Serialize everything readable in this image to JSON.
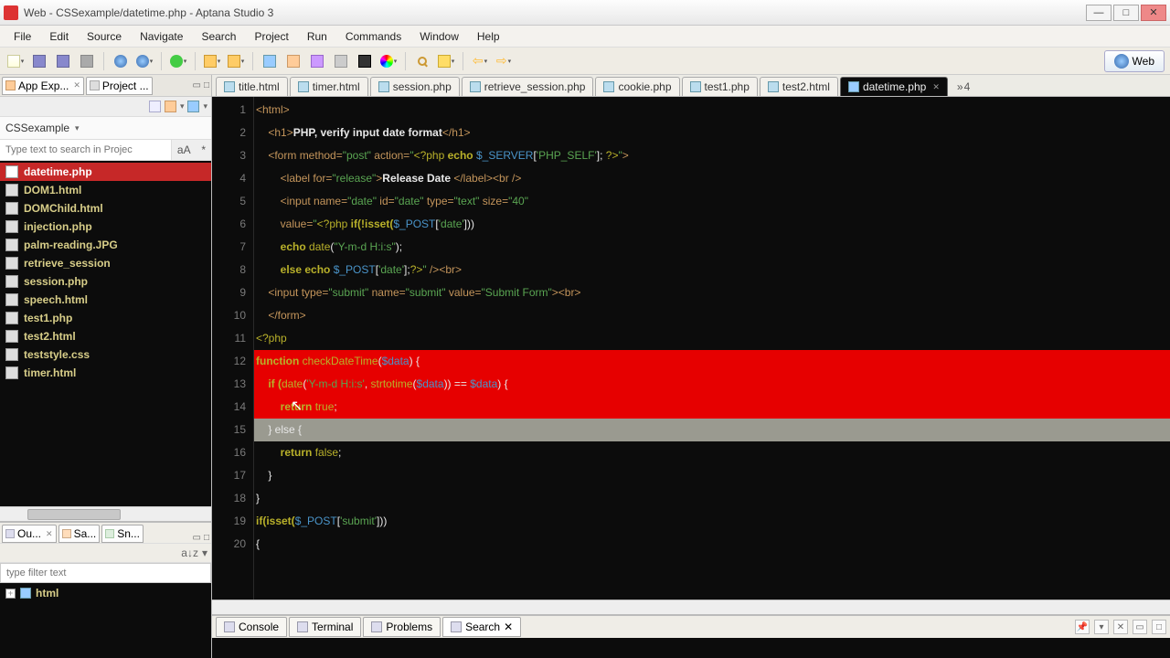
{
  "window": {
    "title": "Web - CSSexample/datetime.php - Aptana Studio 3"
  },
  "menu": [
    "File",
    "Edit",
    "Source",
    "Navigate",
    "Search",
    "Project",
    "Run",
    "Commands",
    "Window",
    "Help"
  ],
  "perspective": {
    "label": "Web"
  },
  "leftViews": {
    "tabs": [
      {
        "label": "App Exp...",
        "closable": true
      },
      {
        "label": "Project ..."
      }
    ],
    "project": "CSSexample",
    "searchPlaceholder": "Type text to search in Projec",
    "searchSide": [
      "aA",
      "*"
    ],
    "files": [
      {
        "name": "datetime.php",
        "selected": true
      },
      {
        "name": "DOM1.html"
      },
      {
        "name": "DOMChild.html"
      },
      {
        "name": "injection.php"
      },
      {
        "name": "palm-reading.JPG"
      },
      {
        "name": "retrieve_session"
      },
      {
        "name": "session.php"
      },
      {
        "name": "speech.html"
      },
      {
        "name": "test1.php"
      },
      {
        "name": "test2.html"
      },
      {
        "name": "teststyle.css"
      },
      {
        "name": "timer.html"
      }
    ]
  },
  "leftBottom": {
    "tabs": [
      {
        "label": "Ou...",
        "closable": true
      },
      {
        "label": "Sa..."
      },
      {
        "label": "Sn..."
      }
    ],
    "filterPlaceholder": "type filter text",
    "rootNode": "html"
  },
  "editorTabs": [
    {
      "label": "title.html"
    },
    {
      "label": "timer.html"
    },
    {
      "label": "session.php"
    },
    {
      "label": "retrieve_session.php"
    },
    {
      "label": "cookie.php"
    },
    {
      "label": "test1.php"
    },
    {
      "label": "test2.html"
    },
    {
      "label": "datetime.php",
      "active": true,
      "closable": true
    }
  ],
  "editorOverflow": {
    "chev": "»",
    "count": "4"
  },
  "code": {
    "lines": [
      1,
      2,
      3,
      4,
      5,
      6,
      7,
      8,
      9,
      10,
      11,
      12,
      13,
      14,
      15,
      16,
      17,
      18,
      19,
      20
    ],
    "l1": {
      "a": "<html>"
    },
    "l2": {
      "a": "    <h1>",
      "b": "PHP, verify input date format",
      "c": "</h1>"
    },
    "l3": {
      "a": "    <form ",
      "b": "method=",
      "c": "\"post\"",
      "d": " action=",
      "e": "\"",
      "f": "<?php",
      "g": " echo ",
      "h": "$_SERVER",
      "i": "[",
      "j": "'PHP_SELF'",
      "k": "]; ",
      "l": "?>",
      "m": "\"",
      "n": ">"
    },
    "l4": {
      "a": "        <label ",
      "b": "for=",
      "c": "\"release\"",
      "d": ">",
      "e": "Release Date ",
      "f": "</label><br />"
    },
    "l5": {
      "a": "        <input ",
      "b": "name=",
      "c": "\"date\"",
      "d": " id=",
      "e": "\"date\"",
      "f": " type=",
      "g": "\"text\"",
      "h": " size=",
      "i": "\"40\""
    },
    "l6": {
      "a": "        value=",
      "b": "\"",
      "c": "<?php",
      "d": " if(!isset(",
      "e": "$_POST",
      "f": "[",
      "g": "'date'",
      "h": "]))"
    },
    "l7": {
      "a": "        echo ",
      "b": "date",
      "c": "(",
      "d": "\"Y-m-d H:i:s\"",
      "e": ");"
    },
    "l8": {
      "a": "        else echo ",
      "b": "$_POST",
      "c": "[",
      "d": "'date'",
      "e": "];",
      "f": "?>",
      "g": "\"",
      "h": " /><br>"
    },
    "l9": {
      "a": "    <input ",
      "b": "type=",
      "c": "\"submit\"",
      "d": " name=",
      "e": "\"submit\"",
      "f": " value=",
      "g": "\"Submit Form\"",
      "h": "><br>"
    },
    "l10": {
      "a": "    </form>"
    },
    "l11": {
      "a": "<?php"
    },
    "l12": {
      "a": "function ",
      "b": "checkDateTime",
      "c": "(",
      "d": "$data",
      "e": ") {"
    },
    "l13": {
      "a": "    if (",
      "b": "date",
      "c": "(",
      "d": "'Y-m-d H:i:s'",
      "e": ", ",
      "f": "strtotime",
      "g": "(",
      "h": "$data",
      "i": ")) == ",
      "j": "$data",
      "k": ") {"
    },
    "l14": {
      "a": "        return ",
      "b": "true",
      "c": ";"
    },
    "l15": {
      "a": "    } else {"
    },
    "l16": {
      "a": "        return ",
      "b": "false",
      "c": ";"
    },
    "l17": {
      "a": "    }"
    },
    "l18": {
      "a": "}"
    },
    "l19": {
      "a": "if(isset(",
      "b": "$_POST",
      "c": "[",
      "d": "'submit'",
      "e": "]))"
    },
    "l20": {
      "a": "{"
    }
  },
  "bottomTabs": [
    {
      "label": "Console"
    },
    {
      "label": "Terminal"
    },
    {
      "label": "Problems"
    },
    {
      "label": "Search",
      "active": true,
      "closable": true
    }
  ]
}
